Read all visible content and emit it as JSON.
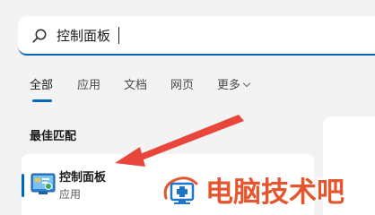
{
  "search": {
    "query": "控制面板",
    "icon": "search-icon"
  },
  "tabs": [
    {
      "label": "全部",
      "active": true
    },
    {
      "label": "应用"
    },
    {
      "label": "文档"
    },
    {
      "label": "网页"
    },
    {
      "label": "更多"
    }
  ],
  "best_match": {
    "section_title": "最佳匹配",
    "result": {
      "name": "控制面板",
      "type": "应用",
      "icon": "control-panel-icon"
    }
  },
  "watermark": {
    "text": "电脑技术吧"
  },
  "colors": {
    "accent": "#0067c0",
    "arrow": "#e8463b",
    "background": "#f3f3f3",
    "watermark": "#e4572e"
  }
}
